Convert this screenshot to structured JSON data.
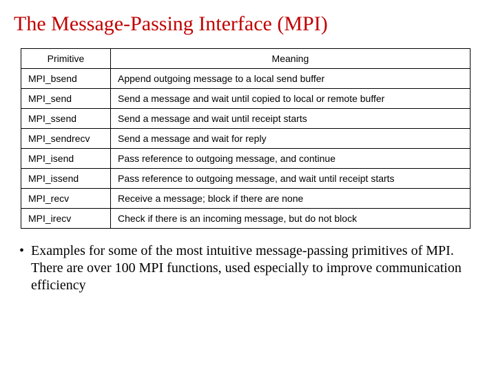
{
  "title": "The Message-Passing Interface (MPI)",
  "table": {
    "headers": {
      "primitive": "Primitive",
      "meaning": "Meaning"
    },
    "rows": [
      {
        "primitive": "MPI_bsend",
        "meaning": "Append outgoing message to a local send buffer"
      },
      {
        "primitive": "MPI_send",
        "meaning": "Send a message and wait until copied to local or remote buffer"
      },
      {
        "primitive": "MPI_ssend",
        "meaning": "Send a message and wait until receipt starts"
      },
      {
        "primitive": "MPI_sendrecv",
        "meaning": "Send a message and wait for reply"
      },
      {
        "primitive": "MPI_isend",
        "meaning": "Pass reference to outgoing message, and continue"
      },
      {
        "primitive": "MPI_issend",
        "meaning": "Pass reference to outgoing message, and wait until receipt starts"
      },
      {
        "primitive": "MPI_recv",
        "meaning": "Receive a message; block if there are none"
      },
      {
        "primitive": "MPI_irecv",
        "meaning": "Check if there is an incoming message, but do not block"
      }
    ]
  },
  "bullet": {
    "marker": "•",
    "text": "Examples for some of the most intuitive message-passing primitives of MPI. There are over 100 MPI functions, used especially to improve communication efficiency"
  }
}
